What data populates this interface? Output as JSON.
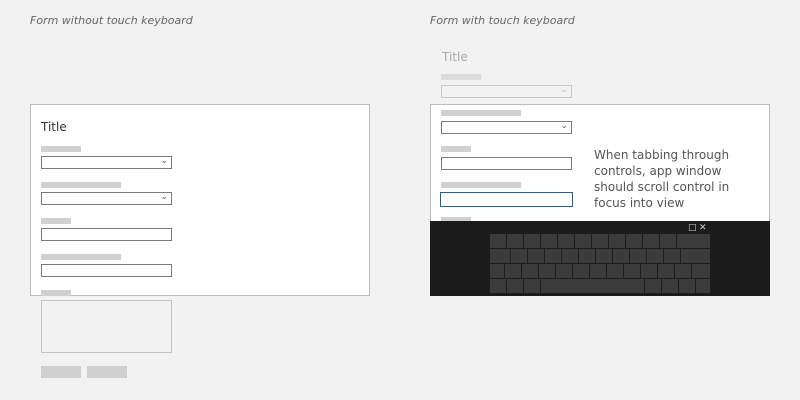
{
  "left_panel": {
    "caption": "Form without touch keyboard",
    "form_title": "Title"
  },
  "right_panel": {
    "caption": "Form with touch keyboard",
    "form_title_scrolled": "Title",
    "note": "When tabbing through controls, app window should scroll control in focus into view"
  },
  "keyboard": {
    "restore_icon": "□",
    "close_icon": "✕"
  }
}
